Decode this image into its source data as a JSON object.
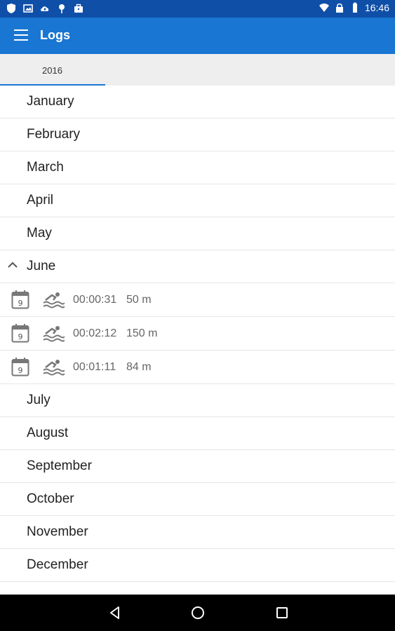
{
  "status": {
    "time": "16:46",
    "left_icons": [
      "shield-icon",
      "image-icon",
      "cloud-upload-icon",
      "location-pin-icon",
      "briefcase-icon"
    ],
    "right_icons": [
      "wifi-icon",
      "lock-icon",
      "battery-icon"
    ]
  },
  "appbar": {
    "title": "Logs",
    "color": "#1976d2",
    "menu_icon": "hamburger-menu-icon"
  },
  "tabs": [
    {
      "label": "2016",
      "selected": true
    }
  ],
  "months_before": [
    {
      "label": "January"
    },
    {
      "label": "February"
    },
    {
      "label": "March"
    },
    {
      "label": "April"
    },
    {
      "label": "May"
    }
  ],
  "expanded_month": {
    "label": "June",
    "chevron_icon": "chevron-up-icon",
    "entries": [
      {
        "day": "9",
        "time": "00:00:31",
        "distance": "50 m",
        "activity_icon": "swimming-icon"
      },
      {
        "day": "9",
        "time": "00:02:12",
        "distance": "150 m",
        "activity_icon": "swimming-icon"
      },
      {
        "day": "9",
        "time": "00:01:11",
        "distance": "84 m",
        "activity_icon": "swimming-icon"
      }
    ]
  },
  "months_after": [
    {
      "label": "July"
    },
    {
      "label": "August"
    },
    {
      "label": "September"
    },
    {
      "label": "October"
    },
    {
      "label": "November"
    },
    {
      "label": "December"
    }
  ],
  "navbar": {
    "icons": [
      "back-icon",
      "home-icon",
      "recents-icon"
    ]
  }
}
